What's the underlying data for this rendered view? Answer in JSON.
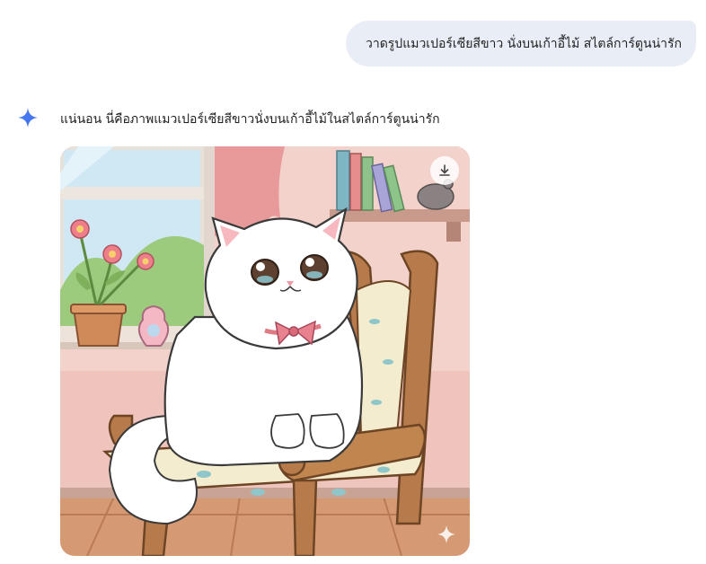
{
  "user_message": {
    "text": "วาดรูปแมวเปอร์เซียสีขาว นั่งบนเก้าอี้ไม้ สไตล์การ์ตูนน่ารัก"
  },
  "assistant_message": {
    "icon": "sparkle-icon",
    "text": "แน่นอน นี่คือภาพแมวเปอร์เซียสีขาวนั่งบนเก้าอี้ไม้ในสไตล์การ์ตูนน่ารัก"
  },
  "generated_image": {
    "download_icon": "download-icon",
    "watermark_icon": "sparkle-watermark-icon"
  },
  "colors": {
    "user_bubble": "#e9eef6",
    "sparkle_blue": "#4285f4",
    "background": "#ffffff"
  }
}
